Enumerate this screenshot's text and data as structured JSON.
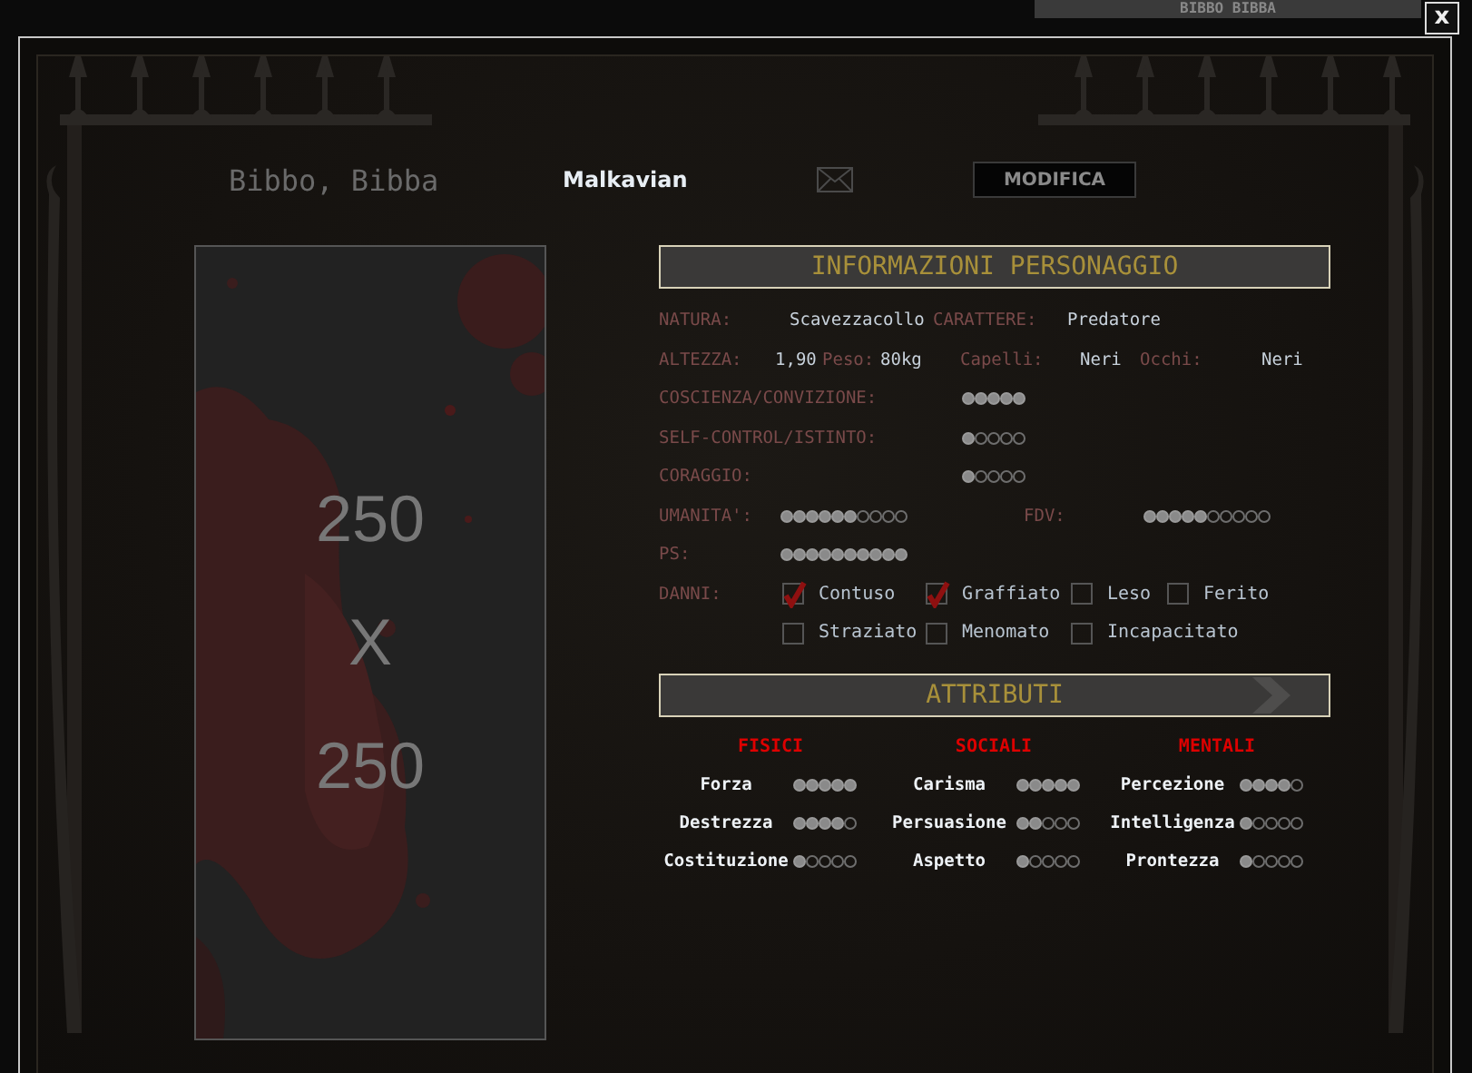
{
  "backdrop": {
    "tab_label": "BIBBO BIBBA"
  },
  "close_button": "x",
  "header": {
    "name": "Bibbo, Bibba",
    "clan": "Malkavian",
    "edit_button": "MODIFICA"
  },
  "portrait": {
    "kind": "picture",
    "caption_lines": [
      "250",
      "X",
      "250"
    ]
  },
  "info": {
    "title": "INFORMAZIONI PERSONAGGIO",
    "nature": {
      "label": "NATURA:",
      "value": "Scavezzacollo"
    },
    "character": {
      "label": "CARATTERE:",
      "value": "Predatore"
    },
    "physical": [
      {
        "label": "ALTEZZA:",
        "value": "1,90"
      },
      {
        "label": "Peso:",
        "value": "80kg"
      },
      {
        "label": "Capelli:",
        "value": "Neri"
      },
      {
        "label": "Occhi:",
        "value": "Neri"
      }
    ],
    "virtues": [
      {
        "label": "COSCIENZA/CONVIZIONE:",
        "stars": 5,
        "kind": "five"
      },
      {
        "label": "SELF-CONTROL/ISTINTO:",
        "stars": 1,
        "kind": "five"
      },
      {
        "label": "CORAGGIO:",
        "stars": 1,
        "kind": "five"
      }
    ],
    "humanity": {
      "label": "UMANITA':",
      "stars": 6,
      "kind": "ten"
    },
    "willpower": {
      "label": "FDV:",
      "stars": 5,
      "kind": "ten"
    },
    "health": {
      "label": "PS:",
      "stars": 10,
      "kind": "ten"
    },
    "damage": {
      "label": "DANNI:",
      "rows": [
        [
          {
            "label": "Contuso",
            "checked": true
          },
          {
            "label": "Graffiato",
            "checked": true
          },
          {
            "label": "Leso",
            "checked": false
          },
          {
            "label": "Ferito",
            "checked": false
          }
        ],
        [
          {
            "label": "Straziato",
            "checked": false
          },
          {
            "label": "Menomato",
            "checked": false
          },
          {
            "label": "Incapacitato",
            "checked": false
          }
        ]
      ]
    }
  },
  "attributes": {
    "title": "ATTRIBUTI",
    "groups": [
      {
        "name": "FISICI",
        "traits": [
          {
            "name": "Forza",
            "stars": 5,
            "kind": "five"
          },
          {
            "name": "Destrezza",
            "stars": 4,
            "kind": "five"
          },
          {
            "name": "Costituzione",
            "stars": 1,
            "kind": "five"
          }
        ]
      },
      {
        "name": "SOCIALI",
        "traits": [
          {
            "name": "Carisma",
            "stars": 5,
            "kind": "five"
          },
          {
            "name": "Persuasione",
            "stars": 2,
            "kind": "five"
          },
          {
            "name": "Aspetto",
            "stars": 1,
            "kind": "five"
          }
        ]
      },
      {
        "name": "MENTALI",
        "traits": [
          {
            "name": "Percezione",
            "stars": 4,
            "kind": "five"
          },
          {
            "name": "Intelligenza",
            "stars": 1,
            "kind": "five"
          },
          {
            "name": "Prontezza",
            "stars": 1,
            "kind": "five"
          }
        ]
      }
    ]
  }
}
